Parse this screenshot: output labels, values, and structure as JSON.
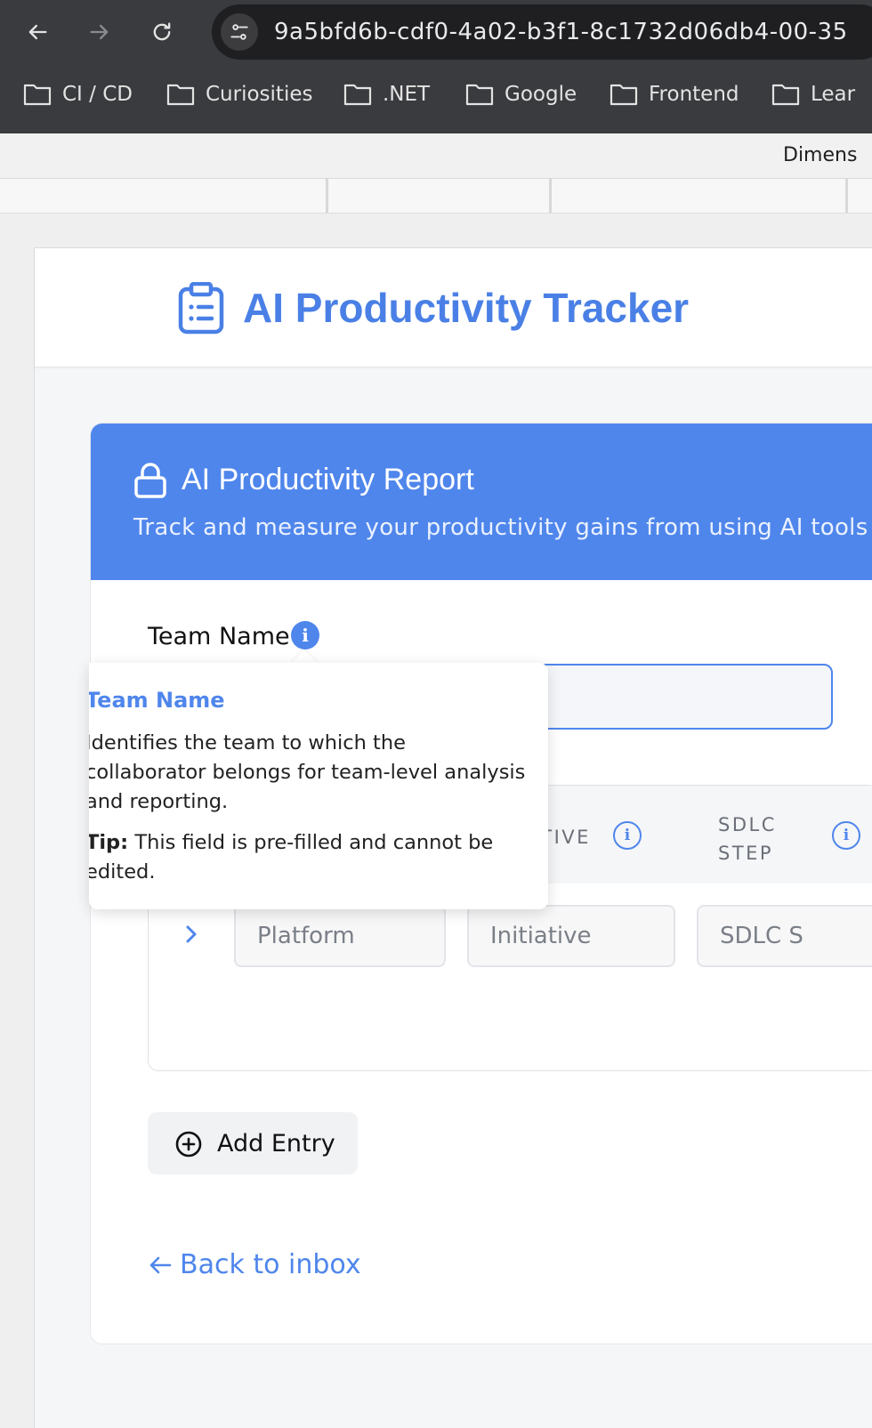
{
  "browser": {
    "url": "9a5bfd6b-cdf0-4a02-b3f1-8c1732d06db4-00-35",
    "bookmarks": [
      "CI / CD",
      "Curiosities",
      ".NET",
      "Google",
      "Frontend",
      "Lear"
    ],
    "dimension_label": "Dimens"
  },
  "app": {
    "title": "AI Productivity Tracker"
  },
  "report": {
    "title": "AI Productivity Report",
    "subtitle": "Track and measure your productivity gains from using AI tools",
    "team_label": "Team Name",
    "info_glyph": "i"
  },
  "tooltip": {
    "title": "Team Name",
    "body": "Identifies the team to which the collaborator belongs for team-level analysis and reporting.",
    "tip_label": "Tip:",
    "tip_text": " This field is pre-filled and cannot be edited."
  },
  "table": {
    "columns": [
      {
        "label": "ATIVE"
      },
      {
        "label": "SDLC STEP"
      }
    ],
    "row": {
      "platform_placeholder": "Platform",
      "initiative_placeholder": "Initiative",
      "sdlc_placeholder": "SDLC S"
    }
  },
  "actions": {
    "add_entry": "Add Entry",
    "back_to_inbox": "Back to inbox"
  },
  "colors": {
    "accent": "#4f86ec",
    "title_blue": "#4a80e6",
    "chrome_dark": "#3a3b3e"
  }
}
